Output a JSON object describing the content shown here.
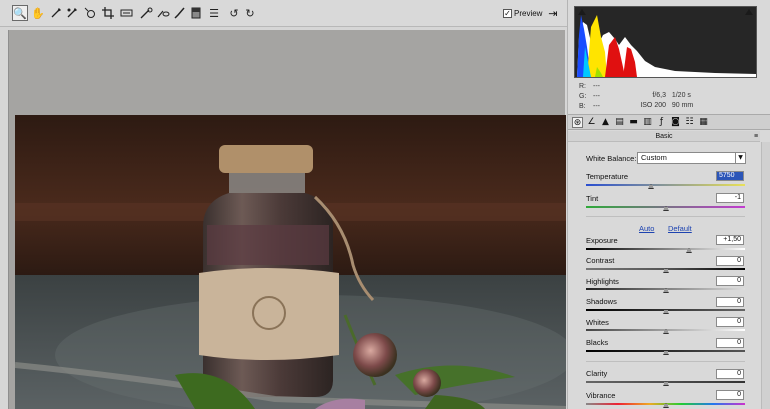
{
  "toolbar": {
    "tools": [
      {
        "icon": "zoom-icon",
        "glyph": "🔍"
      },
      {
        "icon": "hand-icon",
        "glyph": "✋"
      },
      {
        "icon": "white-balance-icon",
        "glyph": "⁄"
      },
      {
        "icon": "color-sampler-icon",
        "glyph": "⁄"
      },
      {
        "icon": "targeted-adjustment-icon",
        "glyph": "◎"
      },
      {
        "icon": "crop-icon",
        "glyph": "⌗"
      },
      {
        "icon": "straighten-icon",
        "glyph": "▭"
      },
      {
        "icon": "spot-removal-icon",
        "glyph": "⁄"
      },
      {
        "icon": "red-eye-icon",
        "glyph": "◉"
      },
      {
        "icon": "adjustment-brush-icon",
        "glyph": "∕"
      },
      {
        "icon": "graduated-filter-icon",
        "glyph": "▣"
      },
      {
        "icon": "preferences-icon",
        "glyph": "☰"
      },
      {
        "icon": "rotate-left-icon",
        "glyph": "↺"
      },
      {
        "icon": "rotate-right-icon",
        "glyph": "↻"
      }
    ],
    "preview_label": "Preview",
    "preview_checked": true,
    "fullscreen_icon": "fullscreen-icon"
  },
  "readout": {
    "r_label": "R:",
    "r_value": "---",
    "g_label": "G:",
    "g_value": "---",
    "b_label": "B:",
    "b_value": "---",
    "aperture": "f/6,3",
    "shutter": "1/20 s",
    "iso": "ISO 200",
    "focal": "90 mm"
  },
  "tabs": [
    "basic-icon",
    "tone-curve-icon",
    "detail-icon",
    "hsl-icon",
    "split-toning-icon",
    "lens-corrections-icon",
    "effects-icon",
    "camera-calibration-icon",
    "presets-icon",
    "snapshots-icon"
  ],
  "section": {
    "title": "Basic",
    "menu_glyph": "≡"
  },
  "white_balance": {
    "label": "White Balance:",
    "value": "Custom"
  },
  "controls": [
    {
      "key": "temperature",
      "label": "Temperature",
      "value": "5750",
      "fraction": 0.41
    },
    {
      "key": "tint",
      "label": "Tint",
      "value": "-1",
      "fraction": 0.5
    },
    {
      "key": "exposure",
      "label": "Exposure",
      "value": "+1,50",
      "fraction": 0.65
    },
    {
      "key": "contrast",
      "label": "Contrast",
      "value": "0",
      "fraction": 0.5
    },
    {
      "key": "highlights",
      "label": "Highlights",
      "value": "0",
      "fraction": 0.5
    },
    {
      "key": "shadows",
      "label": "Shadows",
      "value": "0",
      "fraction": 0.5
    },
    {
      "key": "whites",
      "label": "Whites",
      "value": "0",
      "fraction": 0.5
    },
    {
      "key": "blacks",
      "label": "Blacks",
      "value": "0",
      "fraction": 0.5
    },
    {
      "key": "clarity",
      "label": "Clarity",
      "value": "0",
      "fraction": 0.5
    },
    {
      "key": "vibrance",
      "label": "Vibrance",
      "value": "0",
      "fraction": 0.5
    }
  ],
  "auto_label": "Auto",
  "default_label": "Default",
  "colors": {
    "link": "#1d43b0",
    "selection": "#2b55b8",
    "histogram_bg": "#262626"
  }
}
